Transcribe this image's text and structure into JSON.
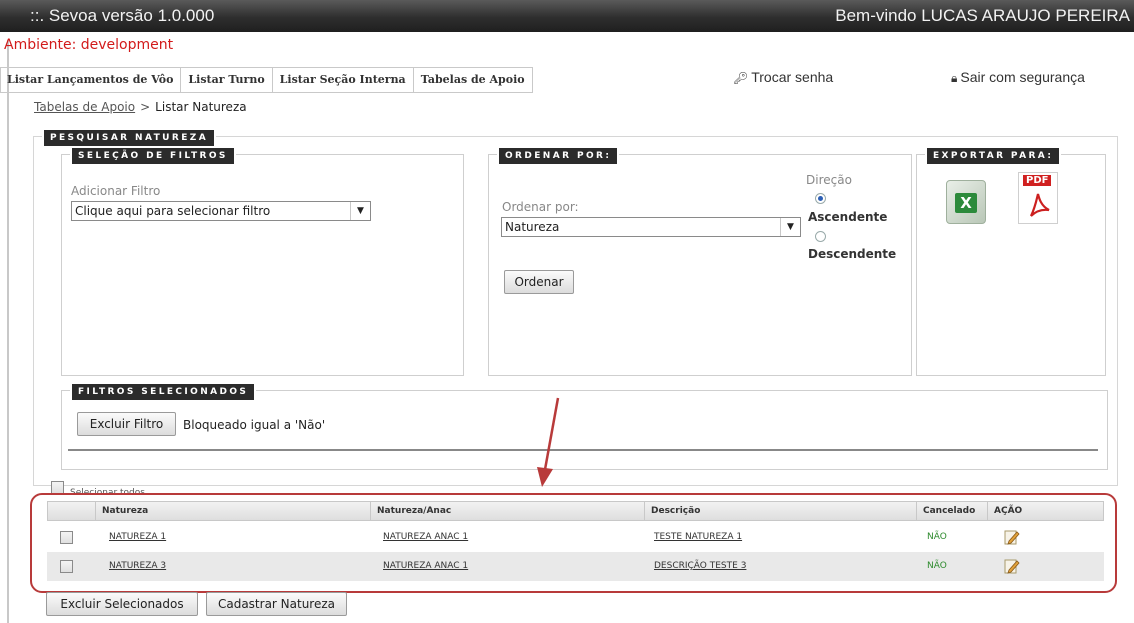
{
  "header": {
    "app_title": "::.  Sevoa versão 1.0.000",
    "welcome": "Bem-vindo LUCAS ARAUJO PEREIRA"
  },
  "environment": "Ambiente: development",
  "nav": {
    "tabs": [
      "Listar Lançamentos de Vôo",
      "Listar Turno",
      "Listar Seção Interna",
      "Tabelas de Apoio"
    ],
    "change_password": "Trocar senha",
    "logout": "Sair com segurança"
  },
  "breadcrumb": {
    "parent": "Tabelas de Apoio",
    "separator": ">",
    "current": "Listar Natureza"
  },
  "search": {
    "legend": "PESQUISAR NATUREZA",
    "filters": {
      "legend": "SELEÇÃO DE FILTROS",
      "add_label": "Adicionar Filtro",
      "select_value": "Clique aqui para selecionar filtro"
    },
    "order": {
      "legend": "ORDENAR POR:",
      "label": "Ordenar por:",
      "select_value": "Natureza",
      "direction_label": "Direção",
      "ascending": "Ascendente",
      "descending": "Descendente",
      "selected": "Ascendente",
      "button": "Ordenar"
    },
    "export": {
      "legend": "EXPORTAR PARA:",
      "pdf_tag": "PDF"
    },
    "selected_filters": {
      "legend": "FILTROS SELECIONADOS",
      "remove_button": "Excluir Filtro",
      "filter_text": "Bloqueado igual a 'Não'"
    }
  },
  "list": {
    "select_all": "Selecionar todos",
    "columns": [
      "Natureza",
      "Natureza/Anac",
      "Descrição",
      "Cancelado",
      "AÇÃO"
    ],
    "rows": [
      {
        "natureza": "NATUREZA 1",
        "anac": "NATUREZA ANAC 1",
        "descricao": "TESTE NATUREZA 1",
        "cancelado": "NÃO"
      },
      {
        "natureza": "NATUREZA 3",
        "anac": "NATUREZA ANAC 1",
        "descricao": "DESCRIÇÃO TESTE 3",
        "cancelado": "NÃO"
      }
    ],
    "delete_selected": "Excluir Selecionados",
    "register": "Cadastrar Natureza"
  },
  "colors": {
    "environment": "#d21a1a",
    "annotation": "#b83a3a",
    "status_no": "#2e8b2e"
  }
}
